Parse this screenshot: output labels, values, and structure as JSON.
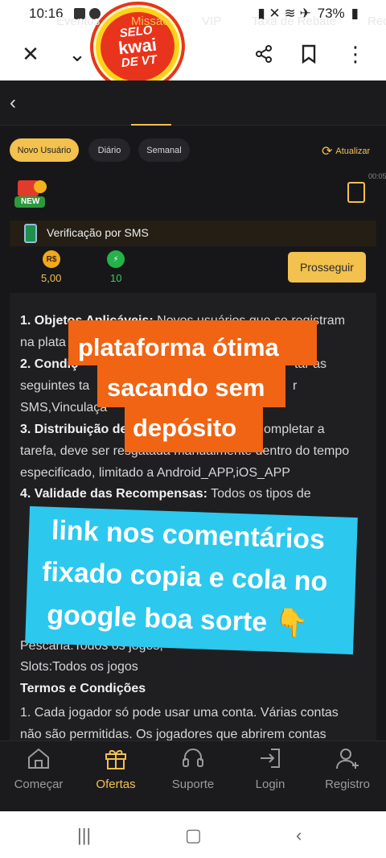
{
  "status_bar": {
    "time": "10:16",
    "battery": "73%"
  },
  "sticker": {
    "line1": "SELO",
    "line2": "kwai",
    "line3": "DE VT"
  },
  "tabs": [
    {
      "label": "Eventos"
    },
    {
      "label": "Missão"
    },
    {
      "label": "VIP"
    },
    {
      "label": "Taxa de Rebate"
    },
    {
      "label": "Rec"
    }
  ],
  "chips": {
    "novo": "Novo Usuário",
    "diario": "Diário",
    "semanal": "Semanal"
  },
  "refresh_label": "Atualizar",
  "timestamp": "00:05",
  "badge_new": "NEW",
  "task": {
    "title": "Verificação por SMS",
    "reward_money": "5,00",
    "reward_money_icon": "R$",
    "reward_points": "10",
    "button": "Prosseguir"
  },
  "content": {
    "p1_label": "1. Objetos Aplicáveis:",
    "p1_text": " Novos usuários que se registram",
    "p1_line2": "na plata",
    "p2_label": "2. Condiç",
    "p2_end": "tar as",
    "p2_line2": "seguintes ta",
    "p2_line2_end": "r",
    "p2_line3": "SMS,Vinculaçã",
    "p3_label": "3. Distribuição de",
    "p3_end": "ompletar a",
    "p3_line2": "tarefa, deve ser resgatada manualmente dentro do tempo",
    "p3_line3": "especificado, limitado a Android_APP,iOS_APP",
    "p4_label": "4. Validade das Recompensas:",
    "p4_text": " Todos os tipos de",
    "pesca": "Pescaria:Todos os jogos,",
    "slots": "Slots:Todos os jogos",
    "terms_title": "Termos e Condições",
    "terms_line1": "1. Cada jogador só pode usar uma conta. Várias contas",
    "terms_line2": "não são permitidas. Os jogadores que abrirem contas"
  },
  "overlay_orange": [
    "plataforma ótima",
    "sacando sem",
    "depósito"
  ],
  "overlay_blue": [
    "link nos comentários",
    "fixado copia e cola no",
    "google boa sorte 👇"
  ],
  "bottom_nav": [
    {
      "label": "Começar",
      "icon": "home-icon"
    },
    {
      "label": "Ofertas",
      "icon": "gift-icon"
    },
    {
      "label": "Suporte",
      "icon": "headset-icon"
    },
    {
      "label": "Login",
      "icon": "login-icon"
    },
    {
      "label": "Registro",
      "icon": "add-user-icon"
    }
  ],
  "colors": {
    "accent": "#f2c14e",
    "background": "#17171a",
    "overlay_orange": "#f06414",
    "overlay_blue": "#2cc8ee"
  }
}
